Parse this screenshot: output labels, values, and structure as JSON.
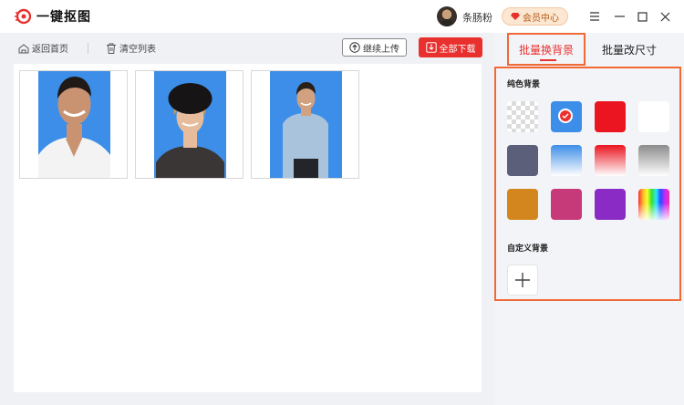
{
  "app": {
    "title": "一键抠图"
  },
  "user": {
    "name": "条肠粉",
    "vip_label": "会员中心"
  },
  "toolbar": {
    "back_home": "返回首页",
    "clear_list": "清空列表",
    "continue_upload": "继续上传",
    "download_all": "全部下载"
  },
  "images": [
    {
      "name": "photo-1",
      "background": "#3d8ee8"
    },
    {
      "name": "photo-2",
      "background": "#3d8ee8"
    },
    {
      "name": "photo-3",
      "background": "#3d8ee8"
    }
  ],
  "panel": {
    "tabs": [
      {
        "label": "批量换背景",
        "active": true
      },
      {
        "label": "批量改尺寸",
        "active": false
      }
    ],
    "solid_title": "纯色背景",
    "custom_title": "自定义背景",
    "swatches": [
      {
        "name": "transparent",
        "type": "transparent"
      },
      {
        "name": "blue",
        "color": "#3d8ee8",
        "selected": true
      },
      {
        "name": "red",
        "color": "#ea1520"
      },
      {
        "name": "white",
        "color": "#ffffff"
      },
      {
        "name": "slate",
        "color": "#5b5f79"
      },
      {
        "name": "blue-gradient",
        "gradient": [
          "#3d8ee8",
          "#ffffff"
        ]
      },
      {
        "name": "red-gradient",
        "gradient": [
          "#ea1520",
          "#ffffff"
        ]
      },
      {
        "name": "gray-gradient",
        "gradient": [
          "#8c8c8c",
          "#ffffff"
        ]
      },
      {
        "name": "orange",
        "color": "#d4861e"
      },
      {
        "name": "magenta",
        "color": "#c63a7a"
      },
      {
        "name": "purple",
        "color": "#8a2bc6"
      },
      {
        "name": "rainbow",
        "type": "rainbow"
      }
    ]
  },
  "colors": {
    "accent": "#e8312f",
    "highlight": "#f06a36",
    "photo_bg": "#3d8ee8"
  }
}
